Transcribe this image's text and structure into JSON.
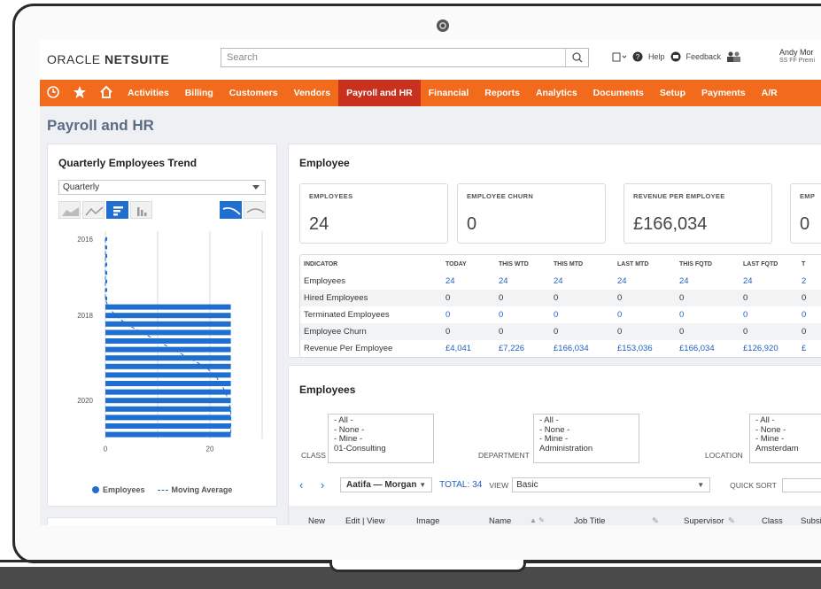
{
  "header": {
    "logo_prefix": "ORACLE",
    "logo_suffix": "NETSUITE",
    "search_placeholder": "Search",
    "help_label": "Help",
    "feedback_label": "Feedback",
    "user_name": "Andy Mor",
    "user_role": "SS FF Premi"
  },
  "nav": {
    "items": [
      "Activities",
      "Billing",
      "Customers",
      "Vendors",
      "Payroll and HR",
      "Financial",
      "Reports",
      "Analytics",
      "Documents",
      "Setup",
      "Payments",
      "A/R"
    ],
    "active": "Payroll and HR"
  },
  "page": {
    "title": "Payroll and HR"
  },
  "trend": {
    "title": "Quarterly Employees Trend",
    "period": "Quarterly",
    "legend_employees": "Employees",
    "legend_moving": "Moving Average"
  },
  "chart_data": {
    "type": "bar",
    "orientation": "horizontal",
    "y_tick_labels": [
      "2016",
      "2018",
      "2020"
    ],
    "x_tick_labels": [
      "0",
      "20"
    ],
    "xlim": [
      0,
      20
    ],
    "legend": [
      "Employees",
      "Moving Average"
    ],
    "series": [
      {
        "name": "Employees",
        "values": [
          0,
          0,
          0,
          0,
          0,
          0,
          0,
          0,
          24,
          24,
          24,
          24,
          24,
          24,
          24,
          24,
          24,
          24,
          24,
          24,
          24,
          24,
          24,
          24
        ]
      },
      {
        "name": "Moving Average",
        "values": [
          0,
          0,
          0,
          0,
          0,
          0,
          0,
          0,
          0.5,
          2,
          4,
          7,
          10,
          13,
          16,
          19,
          21,
          22,
          23,
          23.5,
          24,
          24,
          24,
          24
        ]
      }
    ],
    "colors": {
      "bar": "#1f6fd1",
      "line": "#1f6fd1"
    }
  },
  "employee": {
    "title": "Employee",
    "kpis": [
      {
        "label": "EMPLOYEES",
        "value": "24"
      },
      {
        "label": "EMPLOYEE CHURN",
        "value": "0"
      },
      {
        "label": "REVENUE PER EMPLOYEE",
        "value": "£166,034"
      },
      {
        "label": "EMP",
        "value": "0"
      }
    ],
    "table": {
      "headers": [
        "INDICATOR",
        "TODAY",
        "THIS WTD",
        "THIS MTD",
        "LAST MTD",
        "THIS FQTD",
        "LAST FQTD",
        "T"
      ],
      "rows": [
        [
          "Employees",
          "24",
          "24",
          "24",
          "24",
          "24",
          "24",
          "2"
        ],
        [
          "Hired Employees",
          "0",
          "0",
          "0",
          "0",
          "0",
          "0",
          "0"
        ],
        [
          "Terminated Employees",
          "0",
          "0",
          "0",
          "0",
          "0",
          "0",
          "0"
        ],
        [
          "Employee Churn",
          "0",
          "0",
          "0",
          "0",
          "0",
          "0",
          "0"
        ],
        [
          "Revenue Per Employee",
          "£4,041",
          "£7,226",
          "£166,034",
          "£153,036",
          "£166,034",
          "£126,920",
          "£"
        ]
      ]
    }
  },
  "employees": {
    "title": "Employees",
    "class_label": "CLASS",
    "class_options": [
      "- All -",
      "- None -",
      "- Mine -",
      "01-Consulting"
    ],
    "department_label": "DEPARTMENT",
    "department_options": [
      "- All -",
      "- None -",
      "- Mine -",
      "Administration"
    ],
    "location_label": "LOCATION",
    "location_options": [
      "- All -",
      "- None -",
      "- Mine -",
      "Amsterdam"
    ],
    "range": "Aatifa — Morgan",
    "total_label": "TOTAL:",
    "total_value": "34",
    "view_label": "VIEW",
    "view_value": "Basic",
    "quick_sort_label": "QUICK SORT",
    "columns": [
      "New",
      "Edit | View",
      "Image",
      "Name",
      "Job Title",
      "Supervisor",
      "Class",
      "Subsi"
    ]
  },
  "colors": {
    "nav_bg": "#f26b1c",
    "nav_active": "#c9311f",
    "accent_blue": "#1f6fd1",
    "title_slate": "#5a6c84"
  }
}
